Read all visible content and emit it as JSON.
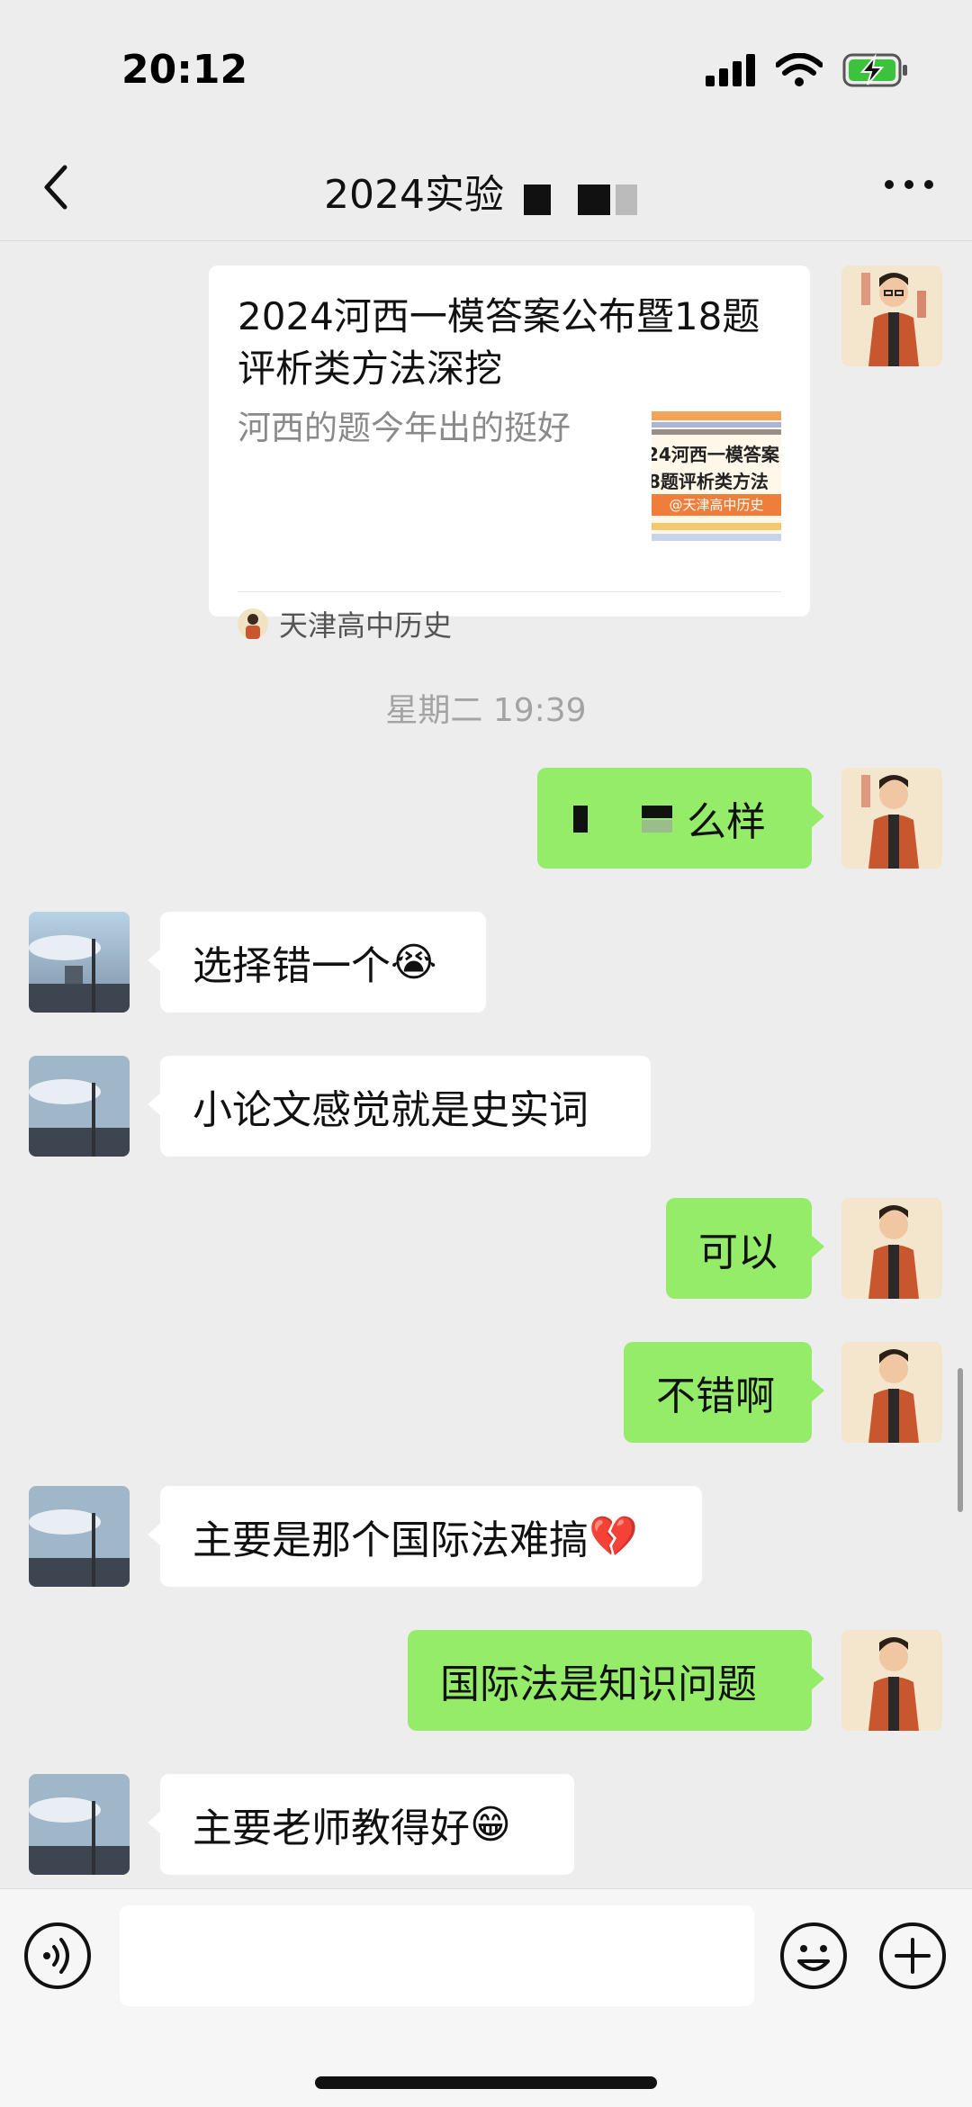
{
  "status_bar": {
    "time": "20:12",
    "battery_color": "#3bc43b"
  },
  "nav": {
    "title": "2024实验",
    "back_icon": "chevron-left-icon",
    "more_icon": "more-dots-icon"
  },
  "shared_card": {
    "title": "2024河西一模答案公布暨18题评析类方法深挖",
    "description": "河西的题今年出的挺好",
    "thumbnail_lines": [
      "24河西一模答案",
      "8题评析类方法",
      "@天津高中历史"
    ],
    "source": "天津高中历史"
  },
  "timestamp": "星期二 19:39",
  "messages": [
    {
      "side": "right",
      "text": "么样",
      "redacted_prefix": true
    },
    {
      "side": "left",
      "text": "选择错一个",
      "emoji": "😭"
    },
    {
      "side": "left",
      "text": "小论文感觉就是史实词"
    },
    {
      "side": "right",
      "text": "可以"
    },
    {
      "side": "right",
      "text": "不错啊"
    },
    {
      "side": "left",
      "text": "主要是那个国际法难搞",
      "emoji": "💔"
    },
    {
      "side": "right",
      "text": "国际法是知识问题"
    },
    {
      "side": "left",
      "text": "主要老师教得好",
      "emoji": "😁"
    }
  ],
  "colors": {
    "self_bubble": "#95ec69",
    "other_bubble": "#ffffff",
    "background": "#ededed"
  },
  "input_bar": {
    "voice_icon": "voice-icon",
    "emoji_icon": "emoji-icon",
    "plus_icon": "plus-icon"
  }
}
